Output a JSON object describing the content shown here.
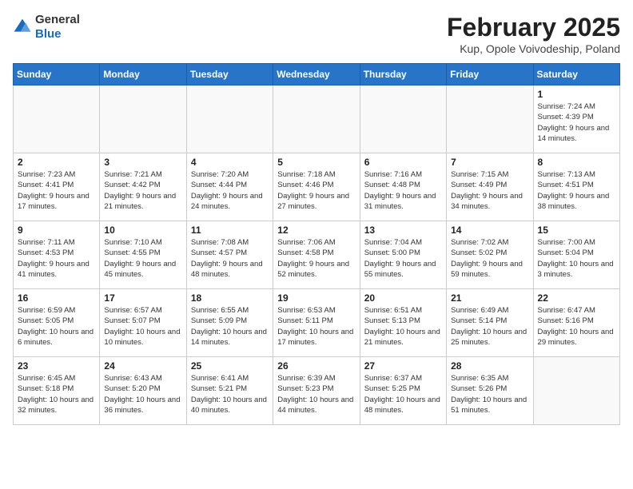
{
  "logo": {
    "text_general": "General",
    "text_blue": "Blue"
  },
  "title": "February 2025",
  "subtitle": "Kup, Opole Voivodeship, Poland",
  "weekdays": [
    "Sunday",
    "Monday",
    "Tuesday",
    "Wednesday",
    "Thursday",
    "Friday",
    "Saturday"
  ],
  "weeks": [
    [
      {
        "day": "",
        "info": ""
      },
      {
        "day": "",
        "info": ""
      },
      {
        "day": "",
        "info": ""
      },
      {
        "day": "",
        "info": ""
      },
      {
        "day": "",
        "info": ""
      },
      {
        "day": "",
        "info": ""
      },
      {
        "day": "1",
        "info": "Sunrise: 7:24 AM\nSunset: 4:39 PM\nDaylight: 9 hours and 14 minutes."
      }
    ],
    [
      {
        "day": "2",
        "info": "Sunrise: 7:23 AM\nSunset: 4:41 PM\nDaylight: 9 hours and 17 minutes."
      },
      {
        "day": "3",
        "info": "Sunrise: 7:21 AM\nSunset: 4:42 PM\nDaylight: 9 hours and 21 minutes."
      },
      {
        "day": "4",
        "info": "Sunrise: 7:20 AM\nSunset: 4:44 PM\nDaylight: 9 hours and 24 minutes."
      },
      {
        "day": "5",
        "info": "Sunrise: 7:18 AM\nSunset: 4:46 PM\nDaylight: 9 hours and 27 minutes."
      },
      {
        "day": "6",
        "info": "Sunrise: 7:16 AM\nSunset: 4:48 PM\nDaylight: 9 hours and 31 minutes."
      },
      {
        "day": "7",
        "info": "Sunrise: 7:15 AM\nSunset: 4:49 PM\nDaylight: 9 hours and 34 minutes."
      },
      {
        "day": "8",
        "info": "Sunrise: 7:13 AM\nSunset: 4:51 PM\nDaylight: 9 hours and 38 minutes."
      }
    ],
    [
      {
        "day": "9",
        "info": "Sunrise: 7:11 AM\nSunset: 4:53 PM\nDaylight: 9 hours and 41 minutes."
      },
      {
        "day": "10",
        "info": "Sunrise: 7:10 AM\nSunset: 4:55 PM\nDaylight: 9 hours and 45 minutes."
      },
      {
        "day": "11",
        "info": "Sunrise: 7:08 AM\nSunset: 4:57 PM\nDaylight: 9 hours and 48 minutes."
      },
      {
        "day": "12",
        "info": "Sunrise: 7:06 AM\nSunset: 4:58 PM\nDaylight: 9 hours and 52 minutes."
      },
      {
        "day": "13",
        "info": "Sunrise: 7:04 AM\nSunset: 5:00 PM\nDaylight: 9 hours and 55 minutes."
      },
      {
        "day": "14",
        "info": "Sunrise: 7:02 AM\nSunset: 5:02 PM\nDaylight: 9 hours and 59 minutes."
      },
      {
        "day": "15",
        "info": "Sunrise: 7:00 AM\nSunset: 5:04 PM\nDaylight: 10 hours and 3 minutes."
      }
    ],
    [
      {
        "day": "16",
        "info": "Sunrise: 6:59 AM\nSunset: 5:05 PM\nDaylight: 10 hours and 6 minutes."
      },
      {
        "day": "17",
        "info": "Sunrise: 6:57 AM\nSunset: 5:07 PM\nDaylight: 10 hours and 10 minutes."
      },
      {
        "day": "18",
        "info": "Sunrise: 6:55 AM\nSunset: 5:09 PM\nDaylight: 10 hours and 14 minutes."
      },
      {
        "day": "19",
        "info": "Sunrise: 6:53 AM\nSunset: 5:11 PM\nDaylight: 10 hours and 17 minutes."
      },
      {
        "day": "20",
        "info": "Sunrise: 6:51 AM\nSunset: 5:13 PM\nDaylight: 10 hours and 21 minutes."
      },
      {
        "day": "21",
        "info": "Sunrise: 6:49 AM\nSunset: 5:14 PM\nDaylight: 10 hours and 25 minutes."
      },
      {
        "day": "22",
        "info": "Sunrise: 6:47 AM\nSunset: 5:16 PM\nDaylight: 10 hours and 29 minutes."
      }
    ],
    [
      {
        "day": "23",
        "info": "Sunrise: 6:45 AM\nSunset: 5:18 PM\nDaylight: 10 hours and 32 minutes."
      },
      {
        "day": "24",
        "info": "Sunrise: 6:43 AM\nSunset: 5:20 PM\nDaylight: 10 hours and 36 minutes."
      },
      {
        "day": "25",
        "info": "Sunrise: 6:41 AM\nSunset: 5:21 PM\nDaylight: 10 hours and 40 minutes."
      },
      {
        "day": "26",
        "info": "Sunrise: 6:39 AM\nSunset: 5:23 PM\nDaylight: 10 hours and 44 minutes."
      },
      {
        "day": "27",
        "info": "Sunrise: 6:37 AM\nSunset: 5:25 PM\nDaylight: 10 hours and 48 minutes."
      },
      {
        "day": "28",
        "info": "Sunrise: 6:35 AM\nSunset: 5:26 PM\nDaylight: 10 hours and 51 minutes."
      },
      {
        "day": "",
        "info": ""
      }
    ]
  ]
}
